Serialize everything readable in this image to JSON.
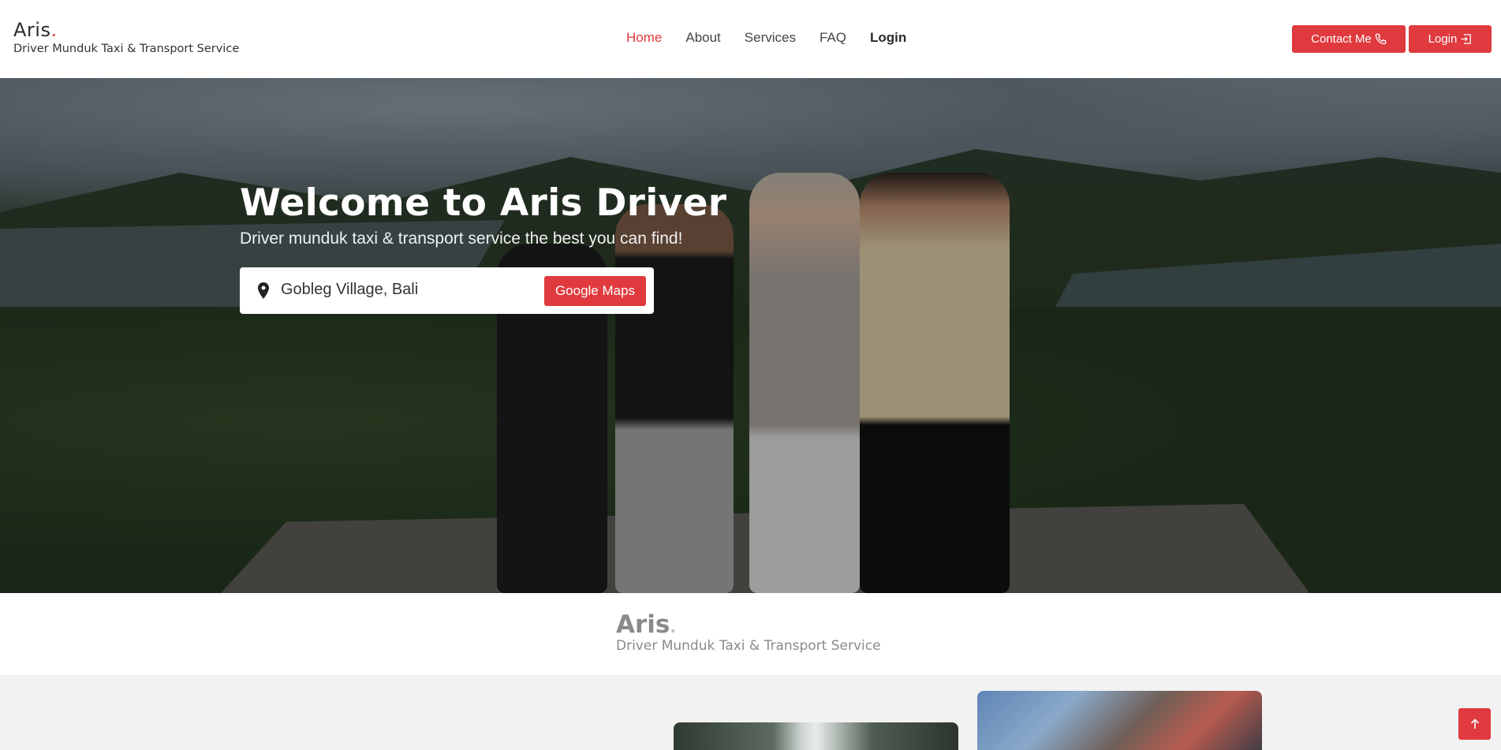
{
  "header": {
    "brand_name": "Aris",
    "brand_dot": ".",
    "brand_tagline": "Driver Munduk Taxi & Transport Service",
    "nav": [
      {
        "label": "Home"
      },
      {
        "label": "About"
      },
      {
        "label": "Services"
      },
      {
        "label": "FAQ"
      },
      {
        "label": "Login"
      }
    ],
    "contact_label": "Contact Me",
    "login_label": "Login"
  },
  "hero": {
    "title": "Welcome to Aris Driver",
    "subtitle": "Driver munduk taxi & transport service the best you can find!",
    "location": "Gobleg Village, Bali",
    "maps_label": "Google Maps"
  },
  "brand_section": {
    "name": "Aris",
    "dot": ".",
    "tagline": "Driver Munduk Taxi & Transport Service"
  },
  "colors": {
    "accent": "#e03a3e"
  },
  "icons": {
    "contact": "phone-icon",
    "login": "login-icon",
    "location": "map-pin-icon",
    "scroll_top": "arrow-up-icon"
  }
}
